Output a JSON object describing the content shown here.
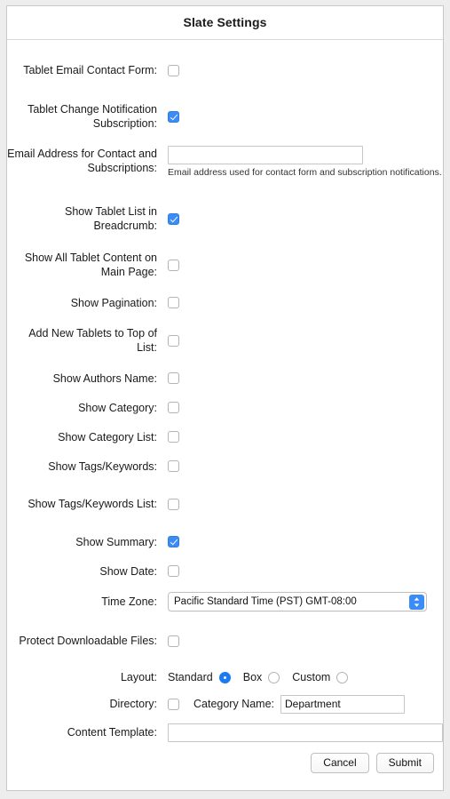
{
  "header": {
    "title": "Slate Settings"
  },
  "rows": {
    "tablet_email_contact_form": {
      "label": "Tablet Email Contact Form:",
      "checked": false
    },
    "tablet_change_notification": {
      "label": "Tablet Change Notification Subscription:",
      "checked": true
    },
    "email_address": {
      "label": "Email Address for Contact and Subscriptions:",
      "value": "",
      "help": "Email address used for contact form and subscription notifications."
    },
    "show_tablet_list_breadcrumb": {
      "label": "Show Tablet List in Breadcrumb:",
      "checked": true
    },
    "show_all_tablet_content": {
      "label": "Show All Tablet Content on Main Page:",
      "checked": false
    },
    "show_pagination": {
      "label": "Show Pagination:",
      "checked": false
    },
    "add_new_tablets_top": {
      "label": "Add New Tablets to Top of List:",
      "checked": false
    },
    "show_authors_name": {
      "label": "Show Authors Name:",
      "checked": false
    },
    "show_category": {
      "label": "Show Category:",
      "checked": false
    },
    "show_category_list": {
      "label": "Show Category List:",
      "checked": false
    },
    "show_tags_keywords": {
      "label": "Show Tags/Keywords:",
      "checked": false
    },
    "show_tags_keywords_list": {
      "label": "Show Tags/Keywords List:",
      "checked": false
    },
    "show_summary": {
      "label": "Show Summary:",
      "checked": true
    },
    "show_date": {
      "label": "Show Date:",
      "checked": false
    },
    "time_zone": {
      "label": "Time Zone:",
      "selected": "Pacific Standard Time (PST) GMT-08:00"
    },
    "protect_downloadable_files": {
      "label": "Protect Downloadable Files:",
      "checked": false
    },
    "layout": {
      "label": "Layout:",
      "options": [
        {
          "label": "Standard",
          "selected": true
        },
        {
          "label": "Box",
          "selected": false
        },
        {
          "label": "Custom",
          "selected": false
        }
      ]
    },
    "directory": {
      "label": "Directory:",
      "checked": false,
      "category_name_label": "Category Name:",
      "category_name_value": "Department"
    },
    "content_template": {
      "label": "Content Template:",
      "value": ""
    }
  },
  "footer": {
    "cancel_label": "Cancel",
    "submit_label": "Submit"
  },
  "colors": {
    "accent": "#3b8cf6",
    "radio_accent": "#1a7cf0",
    "page_background": "#ededed",
    "card_background": "#ffffff",
    "border": "#c8c8c8"
  }
}
